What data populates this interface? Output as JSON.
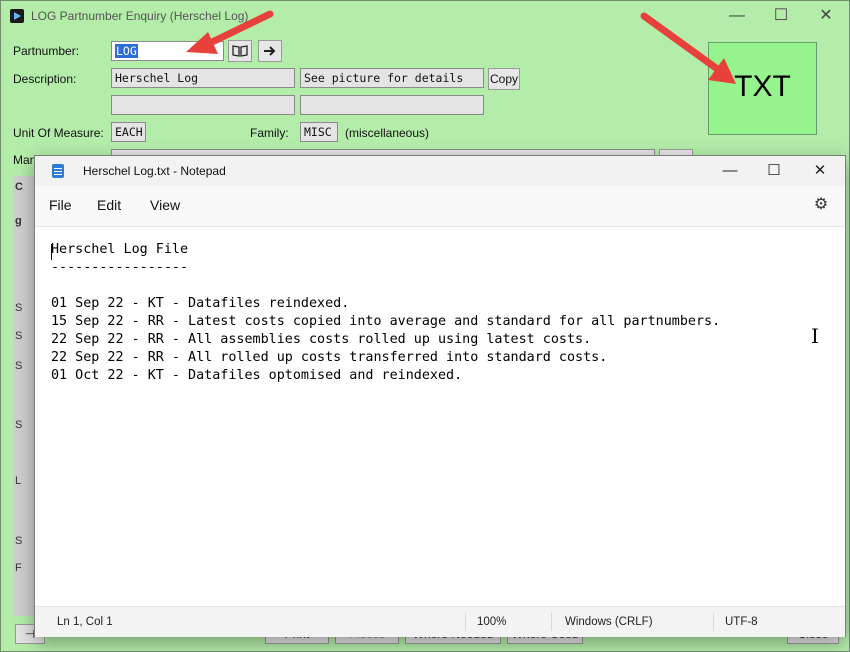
{
  "window": {
    "title": "LOG Partnumber Enquiry (Herschel Log)",
    "minimize": "—",
    "maximize": "☐",
    "close": "✕"
  },
  "form": {
    "partnumber_label": "Partnumber:",
    "partnumber_value": "LOG",
    "description_label": "Description:",
    "description1": "Herschel Log",
    "description2": "See picture for details",
    "description3": "",
    "description4": "",
    "copy_button": "Copy",
    "uom_label": "Unit Of Measure:",
    "uom_value": "EACH",
    "family_label": "Family:",
    "family_value": "MISC",
    "family_desc": "(miscellaneous)",
    "manuf_label": "Man",
    "txt_label": "TXT"
  },
  "background_strip": [
    "C",
    "g",
    "S",
    "S",
    "S",
    "S",
    "L",
    "S",
    "F"
  ],
  "bottom_buttons": [
    "Print",
    "Pieces",
    "Where Needed",
    "Where Used",
    "Close"
  ],
  "notepad": {
    "title": "Herschel Log.txt - Notepad",
    "minimize": "—",
    "maximize": "☐",
    "close": "✕",
    "menu": [
      "File",
      "Edit",
      "View"
    ],
    "lines": [
      "Herschel Log File",
      "-----------------",
      "",
      "01 Sep 22 - KT - Datafiles reindexed.",
      "15 Sep 22 - RR - Latest costs copied into average and standard for all partnumbers.",
      "22 Sep 22 - RR - All assemblies costs rolled up using latest costs.",
      "22 Sep 22 - RR - All rolled up costs transferred into standard costs.",
      "01 Oct 22 - KT - Datafiles optomised and reindexed."
    ],
    "status": {
      "position": "Ln 1, Col 1",
      "zoom": "100%",
      "line_endings": "Windows (CRLF)",
      "encoding": "UTF-8"
    }
  },
  "colors": {
    "app_bg": "#b4edaa",
    "txt_box": "#95f48d",
    "arrow": "#e8403a",
    "selection": "#2b6fd6"
  },
  "icons": [
    "app-icon",
    "book-icon",
    "arrow-right-icon",
    "notepad-icon",
    "gear-icon",
    "ibeam-cursor-icon",
    "pin-icon"
  ]
}
